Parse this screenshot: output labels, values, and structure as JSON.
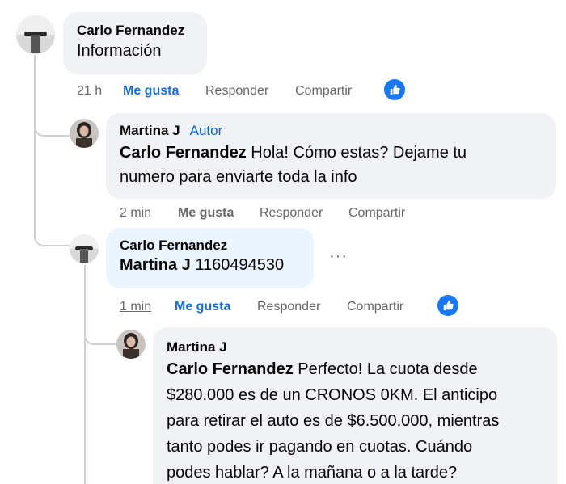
{
  "comments": [
    {
      "author": "Carlo Fernandez",
      "text": "Información",
      "time": "21 h",
      "like": "Me gusta",
      "reply": "Responder",
      "share": "Compartir",
      "liked_icon": "thumbs-up-icon"
    },
    {
      "author": "Martina J",
      "badge": "Autor",
      "mention": "Carlo Fernandez",
      "line1": "Hola! Cómo estas? Dejame tu",
      "line2": "numero para enviarte toda la info",
      "time": "2 min",
      "like": "Me gusta",
      "reply": "Responder",
      "share": "Compartir"
    },
    {
      "author": "Carlo Fernandez",
      "mention": "Martina J",
      "text": "1160494530",
      "time": "1 min",
      "like": "Me gusta",
      "reply": "Responder",
      "share": "Compartir",
      "more": "···",
      "liked_icon": "thumbs-up-icon"
    },
    {
      "author": "Martina J",
      "mention": "Carlo Fernandez",
      "line1": "Perfecto! La cuota desde",
      "line2": "$280.000 es de un CRONOS 0KM. El anticipo",
      "line3": "para retirar el auto es de $6.500.000, mientras",
      "line4": "tanto podes ir pagando en cuotas. Cuándo",
      "line5": "podes hablar? A la mañana o a la tarde?"
    }
  ],
  "colors": {
    "link_blue": "#1a6ed8",
    "badge_blue": "#0064d1",
    "bubble_gray": "#f0f2f5",
    "bubble_blue": "#ebf5ff",
    "meta_gray": "#65676b"
  }
}
